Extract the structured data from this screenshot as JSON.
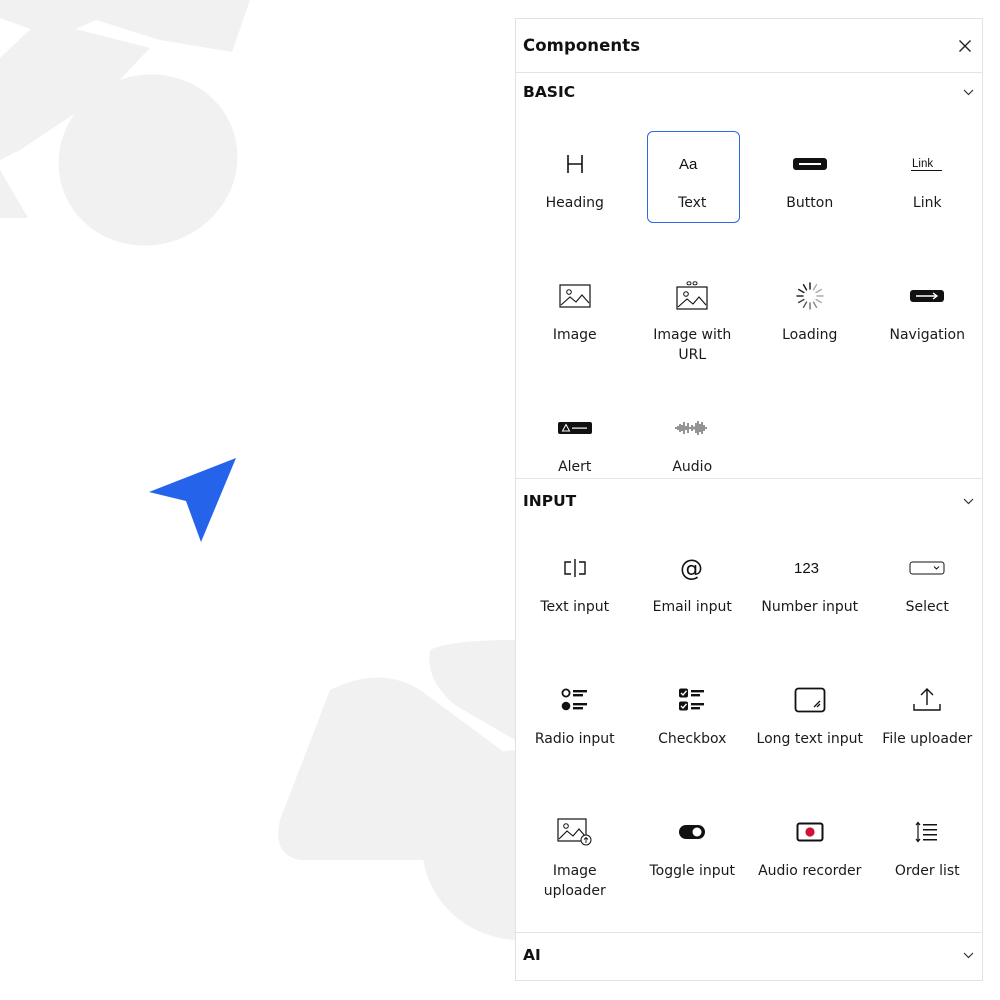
{
  "panel": {
    "title": "Components",
    "close_icon": "close-icon"
  },
  "sections": {
    "basic": {
      "title": "BASIC",
      "items": [
        {
          "label": "Heading",
          "icon": "heading-icon"
        },
        {
          "label": "Text",
          "icon": "text-icon",
          "selected": true
        },
        {
          "label": "Button",
          "icon": "button-icon"
        },
        {
          "label": "Link",
          "icon": "link-icon",
          "icon_text": "Link"
        },
        {
          "label": "Image",
          "icon": "image-icon"
        },
        {
          "label": "Image with URL",
          "icon": "image-url-icon"
        },
        {
          "label": "Loading",
          "icon": "loading-spinner-icon"
        },
        {
          "label": "Navigation",
          "icon": "navigation-icon"
        },
        {
          "label": "Alert",
          "icon": "alert-icon"
        },
        {
          "label": "Audio",
          "icon": "audio-waveform-icon"
        }
      ]
    },
    "input": {
      "title": "INPUT",
      "items": [
        {
          "label": "Text input",
          "icon": "text-input-icon"
        },
        {
          "label": "Email input",
          "icon": "email-at-icon"
        },
        {
          "label": "Number input",
          "icon": "number-input-icon",
          "icon_text": "123"
        },
        {
          "label": "Select",
          "icon": "select-dropdown-icon"
        },
        {
          "label": "Radio input",
          "icon": "radio-list-icon"
        },
        {
          "label": "Checkbox",
          "icon": "checkbox-list-icon"
        },
        {
          "label": "Long text input",
          "icon": "long-text-icon"
        },
        {
          "label": "File uploader",
          "icon": "upload-icon"
        },
        {
          "label": "Image uploader",
          "icon": "image-upload-icon"
        },
        {
          "label": "Toggle input",
          "icon": "toggle-icon"
        },
        {
          "label": "Audio recorder",
          "icon": "record-icon"
        },
        {
          "label": "Order list",
          "icon": "order-list-icon"
        }
      ]
    },
    "ai": {
      "title": "AI"
    }
  },
  "colors": {
    "accent": "#2c68e8",
    "pointer": "#2563eb",
    "record": "#d0103a",
    "background_shapes": "#f1f1f1"
  }
}
